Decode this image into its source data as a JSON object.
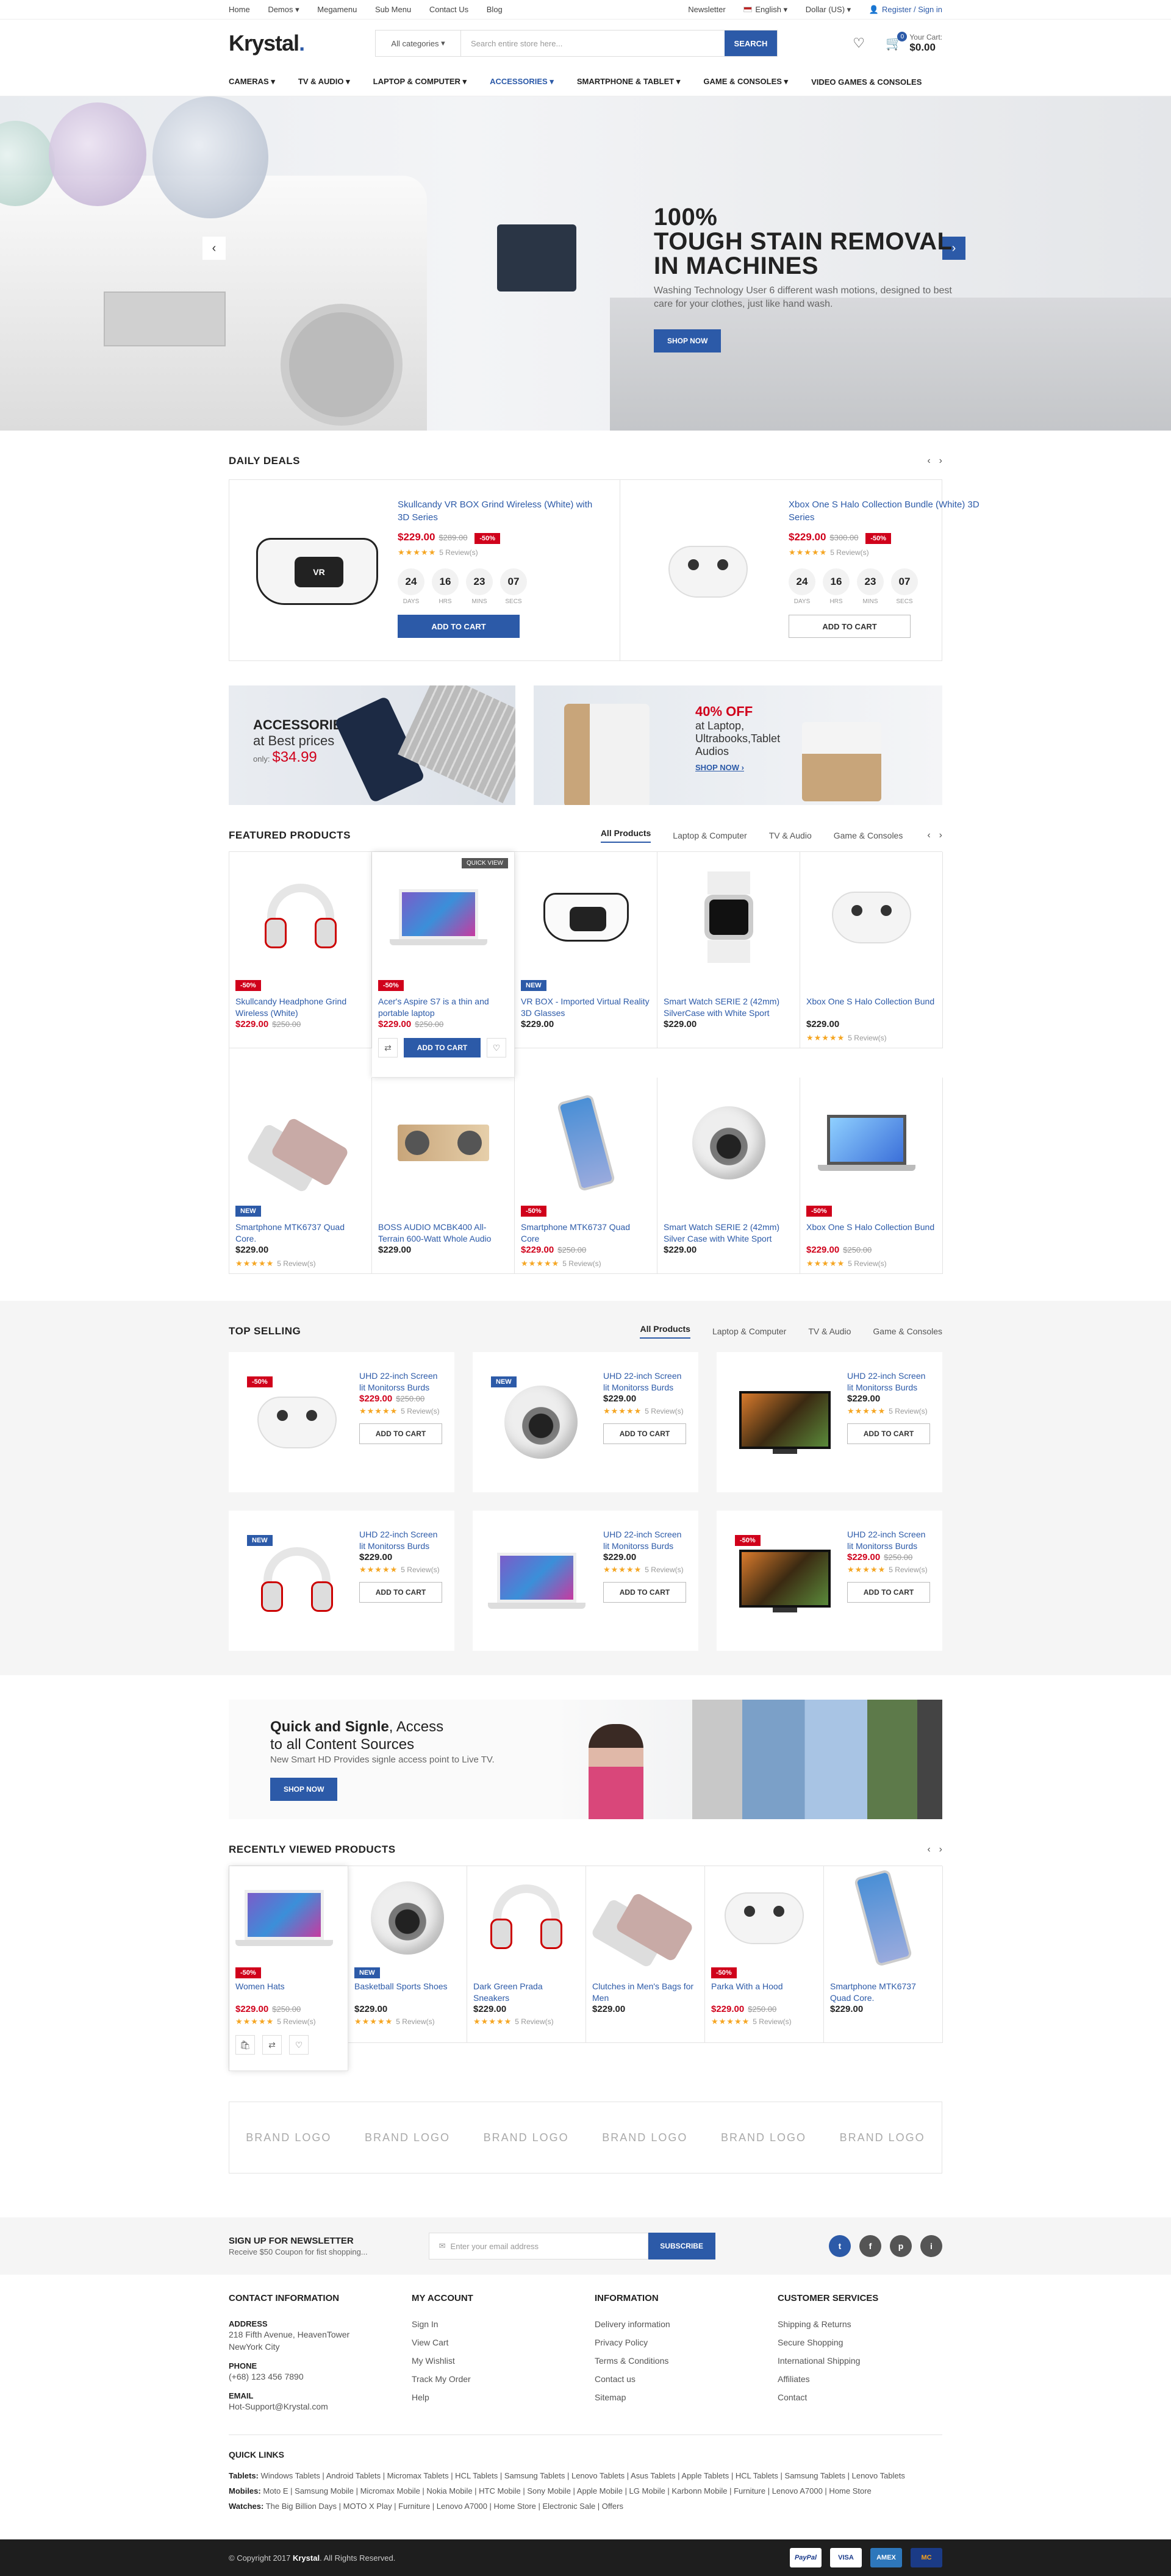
{
  "topbar": {
    "left": [
      "Home",
      "Demos",
      "Megamenu",
      "Sub Menu",
      "Contact Us",
      "Blog"
    ],
    "newsletter": "Newsletter",
    "language": "English",
    "currency": "Dollar (US)",
    "account": "Register / Sign in"
  },
  "header": {
    "logo": "Krystal",
    "logo_dot": ".",
    "search_category": "All categories",
    "search_placeholder": "Search entire store here...",
    "search_button": "SEARCH",
    "cart_count": "0",
    "cart_label": "Your Cart:",
    "cart_total": "$0.00"
  },
  "nav": [
    "CAMERAS",
    "TV & AUDIO",
    "LAPTOP & COMPUTER",
    "ACCESSORIES",
    "SMARTPHONE & TABLET",
    "GAME & CONSOLES",
    "VIDEO GAMES & CONSOLES"
  ],
  "hero": {
    "line1": "100%",
    "line2": "TOUGH STAIN REMOVAL",
    "line3": "IN MACHINES",
    "subtitle": "Washing Technology User 6 different wash motions, designed to best care for your clothes, just like hand wash.",
    "button": "SHOP NOW"
  },
  "daily_deals": {
    "title": "DAILY DEALS",
    "units": [
      "DAYS",
      "HRS",
      "MINS",
      "SECS"
    ],
    "items": [
      {
        "name": "Skullcandy VR BOX Grind Wireless (White) with 3D Series",
        "price": "$229.00",
        "old": "$289.00",
        "badge": "-50%",
        "reviews": "5 Review(s)",
        "count": [
          "24",
          "16",
          "23",
          "07"
        ],
        "button": "ADD TO CART"
      },
      {
        "name": "Xbox One S Halo Collection Bundle (White) 3D Series",
        "price": "$229.00",
        "old": "$300.00",
        "badge": "-50%",
        "reviews": "5 Review(s)",
        "count": [
          "24",
          "16",
          "23",
          "07"
        ],
        "button": "ADD TO CART"
      }
    ]
  },
  "banners": {
    "a": {
      "title": "ACCESSORIES",
      "sub": "at Best prices",
      "only": "only:",
      "price": "$34.99"
    },
    "b": {
      "title": "40% OFF",
      "l1": "at Laptop,",
      "l2": "Ultrabooks,Tablet",
      "l3": "Audios",
      "link": "SHOP NOW"
    }
  },
  "featured": {
    "title": "FEATURED PRODUCTS",
    "tabs": [
      "All Products",
      "Laptop & Computer",
      "TV & Audio",
      "Game & Consoles"
    ],
    "quick_view": "QUICK VIEW",
    "add_to_cart": "ADD TO CART",
    "products": [
      {
        "name": "Skullcandy Headphone Grind Wireless (White)",
        "price": "$229.00",
        "old": "$250.00",
        "badge": "-50%",
        "icon": "headphones",
        "sale": true
      },
      {
        "name": "Acer's Aspire S7 is a thin and portable laptop",
        "price": "$229.00",
        "old": "$250.00",
        "badge": "-50%",
        "icon": "laptop",
        "sale": true,
        "hover": true
      },
      {
        "name": "VR BOX - Imported Virtual Reality 3D Glasses",
        "price": "$229.00",
        "badge": "NEW",
        "icon": "vr"
      },
      {
        "name": "Smart Watch SERIE 2 (42mm) SilverCase with White Sport",
        "price": "$229.00",
        "icon": "watch"
      },
      {
        "name": "Xbox One S Halo Collection Bund",
        "price": "$229.00",
        "reviews": "5 Review(s)",
        "icon": "controller"
      },
      {
        "name": "Smartphone MTK6737 Quad Core.",
        "price": "$229.00",
        "badge": "NEW",
        "reviews": "5 Review(s)",
        "icon": "phone"
      },
      {
        "name": "BOSS AUDIO MCBK400 All-Terrain 600-Watt Whole Audio",
        "price": "$229.00",
        "icon": "speaker"
      },
      {
        "name": "Smartphone MTK6737 Quad Core",
        "price": "$229.00",
        "old": "$250.00",
        "badge": "-50%",
        "reviews": "5 Review(s)",
        "icon": "phone2",
        "sale": true
      },
      {
        "name": "Smart Watch SERIE 2 (42mm) Silver Case with White Sport",
        "price": "$229.00",
        "icon": "camera360"
      },
      {
        "name": "Xbox One S Halo Collection Bund",
        "price": "$229.00",
        "old": "$250.00",
        "badge": "-50%",
        "reviews": "5 Review(s)",
        "icon": "laptop2",
        "sale": true
      }
    ]
  },
  "top_selling": {
    "title": "TOP SELLING",
    "tabs": [
      "All Products",
      "Laptop & Computer",
      "TV & Audio",
      "Game & Consoles"
    ],
    "items": [
      {
        "name": "UHD 22-inch Screen lit Monitorss Burds",
        "price": "$229.00",
        "old": "$250.00",
        "badge": "-50%",
        "icon": "controller",
        "sale": true
      },
      {
        "name": "UHD 22-inch Screen lit Monitorss Burds",
        "price": "$229.00",
        "badge": "NEW",
        "icon": "camera360"
      },
      {
        "name": "UHD 22-inch Screen lit Monitorss Burds",
        "price": "$229.00",
        "icon": "tv"
      },
      {
        "name": "UHD 22-inch Screen lit Monitorss Burds",
        "price": "$229.00",
        "badge": "NEW",
        "icon": "headphones"
      },
      {
        "name": "UHD 22-inch Screen lit Monitorss Burds",
        "price": "$229.00",
        "icon": "laptop"
      },
      {
        "name": "UHD 22-inch Screen lit Monitorss Burds",
        "price": "$229.00",
        "old": "$250.00",
        "badge": "-50%",
        "icon": "tv",
        "sale": true
      }
    ],
    "reviews": "5 Review(s)",
    "button": "ADD TO CART"
  },
  "promo": {
    "bold": "Quick and Signle",
    "rest": ", Access",
    "line2": "to all Content Sources",
    "sub": "New Smart HD Provides signle access point to Live TV.",
    "button": "SHOP NOW"
  },
  "recent": {
    "title": "RECENTLY VIEWED PRODUCTS",
    "items": [
      {
        "name": "Women Hats",
        "price": "$229.00",
        "old": "$250.00",
        "badge": "-50%",
        "reviews": "5 Review(s)",
        "icon": "laptop",
        "sale": true,
        "hover": true
      },
      {
        "name": "Basketball Sports Shoes",
        "price": "$229.00",
        "badge": "NEW",
        "reviews": "5 Review(s)",
        "icon": "camera360"
      },
      {
        "name": "Dark Green Prada Sneakers",
        "price": "$229.00",
        "reviews": "5 Review(s)",
        "icon": "headphones"
      },
      {
        "name": "Clutches in Men's Bags for Men",
        "price": "$229.00",
        "icon": "phone"
      },
      {
        "name": "Parka With a Hood",
        "price": "$229.00",
        "old": "$250.00",
        "badge": "-50%",
        "reviews": "5 Review(s)",
        "icon": "controller",
        "sale": true
      },
      {
        "name": "Smartphone MTK6737 Quad Core.",
        "price": "$229.00",
        "icon": "phone2"
      }
    ]
  },
  "brands": {
    "bold": "BRAND",
    "light": "LOGO",
    "count": 6
  },
  "newsletter": {
    "title": "SIGN UP FOR NEWSLETTER",
    "sub": "Receive $50 Coupon for fist shopping...",
    "placeholder": "Enter your email address",
    "button": "SUBSCRIBE",
    "social": [
      "t",
      "f",
      "p",
      "i"
    ]
  },
  "footer": {
    "contact": {
      "title": "CONTACT INFORMATION",
      "address_label": "ADDRESS",
      "address": "218 Fifth Avenue, HeavenTower NewYork City",
      "phone_label": "PHONE",
      "phone": "(+68) 123 456 7890",
      "email_label": "EMAIL",
      "email": "Hot-Support@Krystal.com"
    },
    "account": {
      "title": "MY ACCOUNT",
      "links": [
        "Sign In",
        "View Cart",
        "My Wishlist",
        "Track My Order",
        "Help"
      ]
    },
    "information": {
      "title": "INFORMATION",
      "links": [
        "Delivery information",
        "Privacy Policy",
        "Terms & Conditions",
        "Contact us",
        "Sitemap"
      ]
    },
    "service": {
      "title": "CUSTOMER SERVICES",
      "links": [
        "Shipping & Returns",
        "Secure Shopping",
        "International Shipping",
        "Affiliates",
        "Contact"
      ]
    },
    "quick": {
      "title": "QUICK LINKS",
      "tablets_label": "Tablets:",
      "tablets": "Windows Tablets | Android Tablets | Micromax Tablets | HCL Tablets | Samsung Tablets | Lenovo Tablets | Asus Tablets | Apple Tablets | HCL Tablets | Samsung Tablets | Lenovo Tablets",
      "mobiles_label": "Mobiles:",
      "mobiles": "Moto E | Samsung Mobile | Micromax Mobile | Nokia Mobile | HTC Mobile | Sony Mobile | Apple Mobile | LG Mobile | Karbonn Mobile | Furniture | Lenovo A7000 | Home Store",
      "watches_label": "Watches:",
      "watches": "The Big Billion Days | MOTO X Play | Furniture | Lenovo A7000 | Home Store | Electronic Sale | Offers"
    },
    "copyright_pre": "© Copyright 2017",
    "copyright_brand": "Krystal",
    "copyright_post": ". All Rights Reserved.",
    "payments": [
      "PayPal",
      "VISA",
      "AMEX",
      "MC"
    ]
  }
}
